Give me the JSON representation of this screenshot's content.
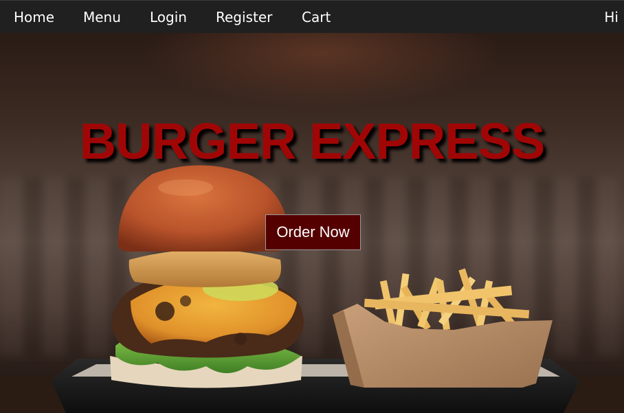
{
  "nav": {
    "items": [
      {
        "label": "Home"
      },
      {
        "label": "Menu"
      },
      {
        "label": "Login"
      },
      {
        "label": "Register"
      },
      {
        "label": "Cart"
      }
    ],
    "greeting": "Hi"
  },
  "hero": {
    "title": "BURGER EXPRESS",
    "cta_label": "Order Now",
    "image": "burger-and-fries-photo"
  },
  "colors": {
    "navbar_bg": "#202020",
    "title": "#a10606",
    "cta_bg": "#550000",
    "nav_text": "#ffffff"
  }
}
